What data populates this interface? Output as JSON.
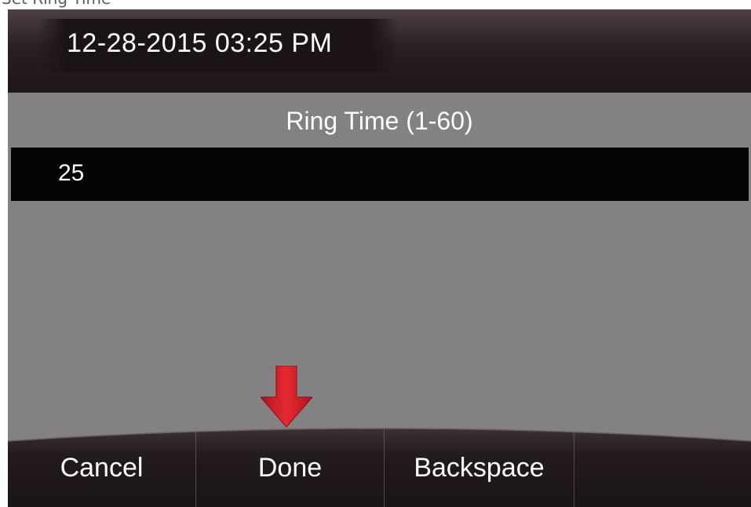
{
  "header": {
    "datetime": "12-28-2015 03:25 PM"
  },
  "dialog": {
    "title": "Ring Time (1-60)",
    "input_value": "25"
  },
  "softkeys": [
    {
      "label": "Cancel"
    },
    {
      "label": "Done"
    },
    {
      "label": "Backspace"
    },
    {
      "label": ""
    }
  ],
  "overlay": {
    "arrow_color": "#e0202a",
    "arrow_icon": "down-arrow-icon"
  },
  "colors": {
    "screen_background": "#838183",
    "header_background": "#2a1f21",
    "input_background": "#050405",
    "text": "#ffffff"
  }
}
